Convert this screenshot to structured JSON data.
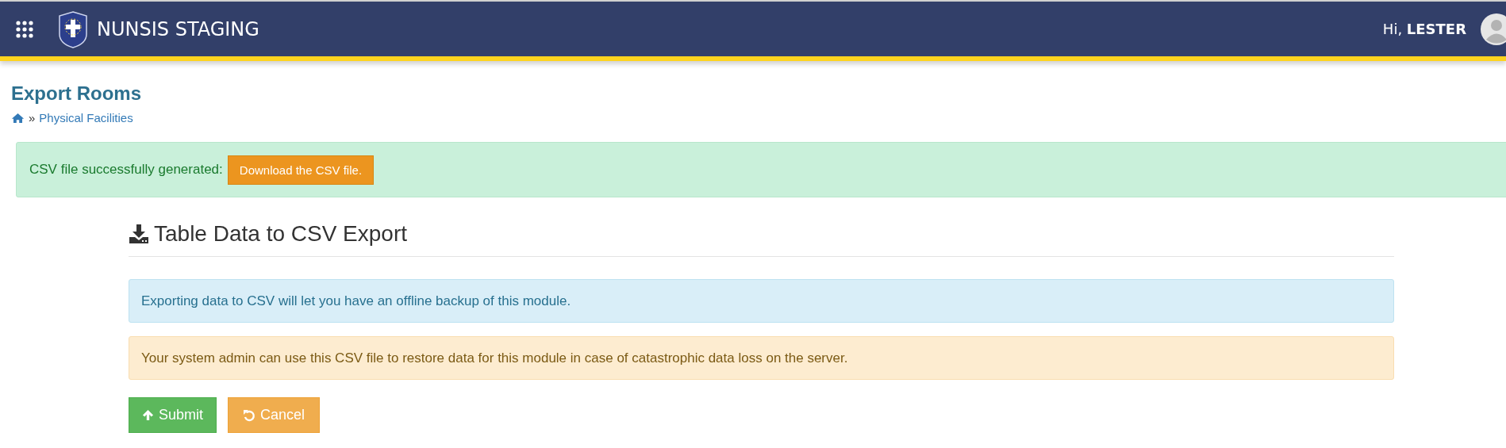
{
  "header": {
    "title": "NUNSIS STAGING",
    "greeting": "Hi, **LESTER**"
  },
  "page": {
    "title": "Export Rooms",
    "breadcrumb_separator": "»",
    "breadcrumb": [
      "Physical Facilities"
    ]
  },
  "success_alert": {
    "text": "CSV file successfully generated:",
    "button": "Download the CSV file."
  },
  "panel": {
    "heading": "Table Data to CSV Export",
    "alerts": [
      {
        "kind": "info",
        "text": "Exporting data to CSV will let you have an offline backup of this module."
      },
      {
        "kind": "warning",
        "text": "Your system admin can use this CSV file to restore data for this module in case of catastrophic data loss on the server."
      }
    ],
    "buttons": [
      {
        "kind": "submit",
        "label": "Submit"
      },
      {
        "kind": "cancel",
        "label": "Cancel"
      }
    ]
  }
}
